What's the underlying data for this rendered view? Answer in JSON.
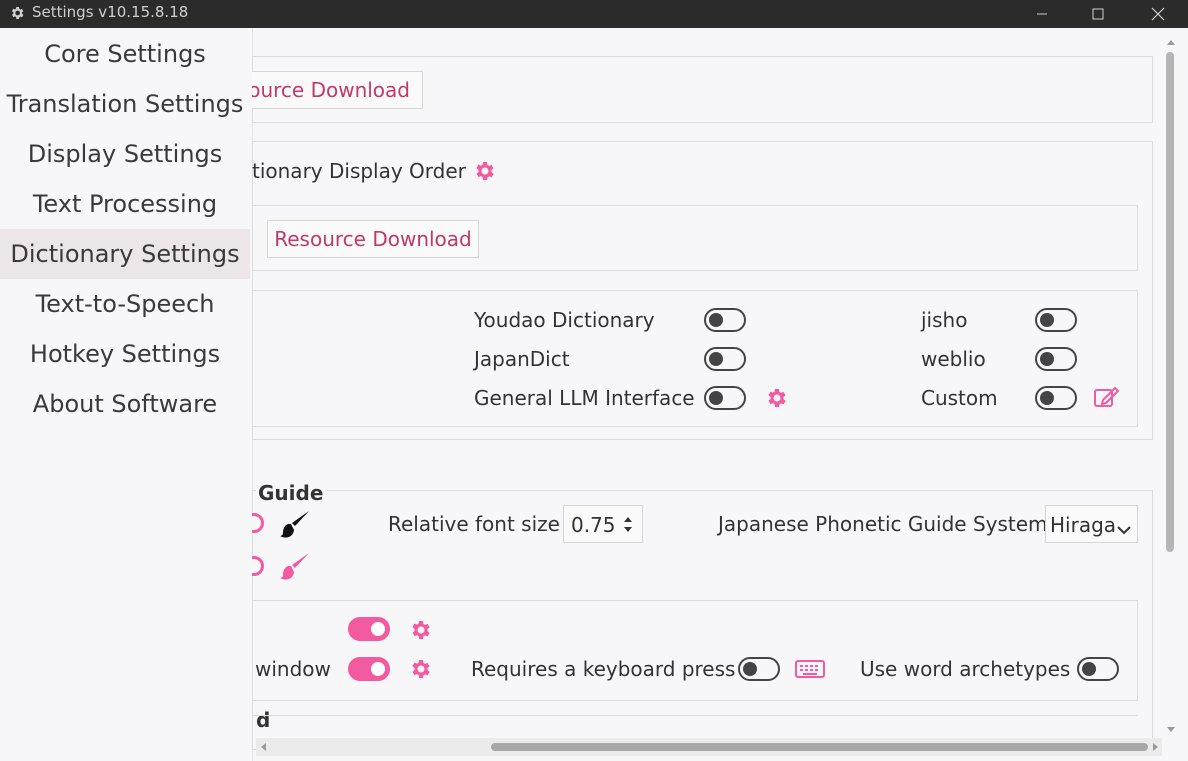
{
  "window": {
    "title": "Settings v10.15.8.18"
  },
  "sidebar": {
    "items": [
      {
        "label": "Core Settings"
      },
      {
        "label": "Translation Settings"
      },
      {
        "label": "Display Settings"
      },
      {
        "label": "Text Processing"
      },
      {
        "label": "Dictionary Settings",
        "active": true
      },
      {
        "label": "Text-to-Speech"
      },
      {
        "label": "Hotkey Settings"
      },
      {
        "label": "About Software"
      }
    ]
  },
  "main": {
    "top_download_label": "ource Download",
    "display_order_label": "tionary Display Order",
    "resource_download_label": "Resource Download",
    "dictionaries": [
      {
        "name": "Youdao Dictionary",
        "enabled": false
      },
      {
        "name": "jisho",
        "enabled": false
      },
      {
        "name": "JapanDict",
        "enabled": false
      },
      {
        "name": "weblio",
        "enabled": false
      },
      {
        "name": "General LLM Interface",
        "enabled": false
      },
      {
        "name": "Custom",
        "enabled": false
      }
    ],
    "phonetic_guide_title": "Guide",
    "relative_font_size_label": "Relative font size",
    "relative_font_size_value": "0.75",
    "phonetic_system_label": "Japanese Phonetic Guide System",
    "phonetic_system_value": "Hiraga",
    "window_label": "window",
    "keyboard_press_label": "Requires a keyboard press",
    "word_archetypes_label": "Use word archetypes",
    "section_d_label": "d"
  },
  "colors": {
    "accent": "#f25b9f",
    "link_text": "#c2386a",
    "titlebar": "#2b2b2b",
    "active_sidebar": "#ece6e8"
  },
  "icons": {
    "gear": "gear-icon",
    "brush": "brush-icon",
    "edit": "edit-icon",
    "keyboard": "keyboard-icon"
  }
}
